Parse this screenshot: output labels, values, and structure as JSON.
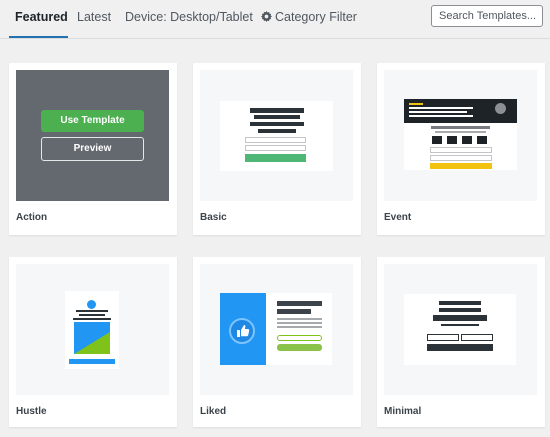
{
  "tabs": [
    {
      "label": "Featured",
      "active": true
    },
    {
      "label": "Latest"
    },
    {
      "label": "Device: Desktop/Tablet"
    },
    {
      "label": "Category Filter",
      "icon": "gear-icon"
    }
  ],
  "search": {
    "placeholder": "Search Templates..."
  },
  "templates": [
    {
      "name": "Action",
      "hovered": true,
      "use_label": "Use Template",
      "preview_label": "Preview"
    },
    {
      "name": "Basic"
    },
    {
      "name": "Event"
    },
    {
      "name": "Hustle"
    },
    {
      "name": "Liked"
    },
    {
      "name": "Minimal"
    }
  ],
  "colors": {
    "accent": "#2271b1",
    "green": "#4caf50",
    "blue": "#2196f3",
    "yellow": "#f2c211",
    "overlay": "#646970"
  }
}
